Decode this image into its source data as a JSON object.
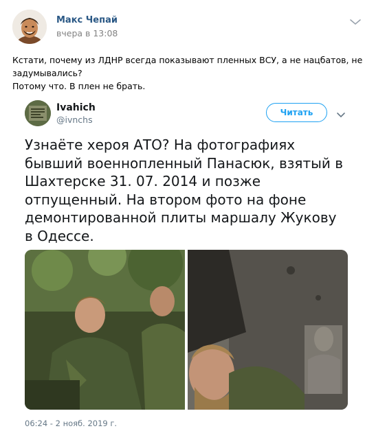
{
  "post": {
    "author": "Макс Чепай",
    "time": "вчера в 13:08",
    "text_lines": [
      "Кстати, почему из ЛДНР всегда показывают пленных ВСУ, а не нацбатов, не",
      "задумывались?",
      "Потому что. В плен не брать."
    ],
    "menu_icon": "chevron-down-icon"
  },
  "tweet": {
    "name": "Ivahich",
    "handle": "@ivnchs",
    "follow_label": "Читать",
    "text_lines": [
      "Узнаёте хероя АТО? На фотографиях",
      "бывший военнопленный Панасюк, взятый в",
      "Шахтерске 31. 07. 2014 и позже",
      "отпущенный. На втором фото на фоне",
      "демонтированной плиты маршалу Жукову",
      "в Одессе."
    ],
    "time": "06:24 - 2 нояб. 2019 г.",
    "colors": {
      "accent": "#1da1f2",
      "name_link": "#2a5885",
      "muted": "#657786"
    }
  }
}
